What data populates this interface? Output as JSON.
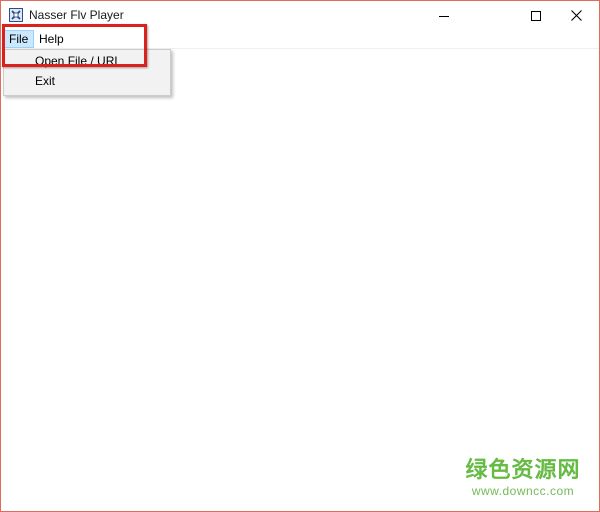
{
  "window": {
    "title": "Nasser Flv Player",
    "icon": "app-icon",
    "controls": {
      "minimize": "minimize-icon",
      "maximize": "maximize-icon",
      "close": "close-icon"
    }
  },
  "menubar": {
    "items": [
      {
        "label": "File",
        "active": true
      },
      {
        "label": "Help",
        "active": false
      }
    ]
  },
  "file_menu": {
    "items": [
      {
        "label": "Open File / URL"
      },
      {
        "label": "Exit"
      }
    ]
  },
  "annotation": {
    "color": "#d9221c"
  },
  "watermark": {
    "text": "绿色资源网",
    "url": "www.downcc.com",
    "color": "#66bb44"
  }
}
